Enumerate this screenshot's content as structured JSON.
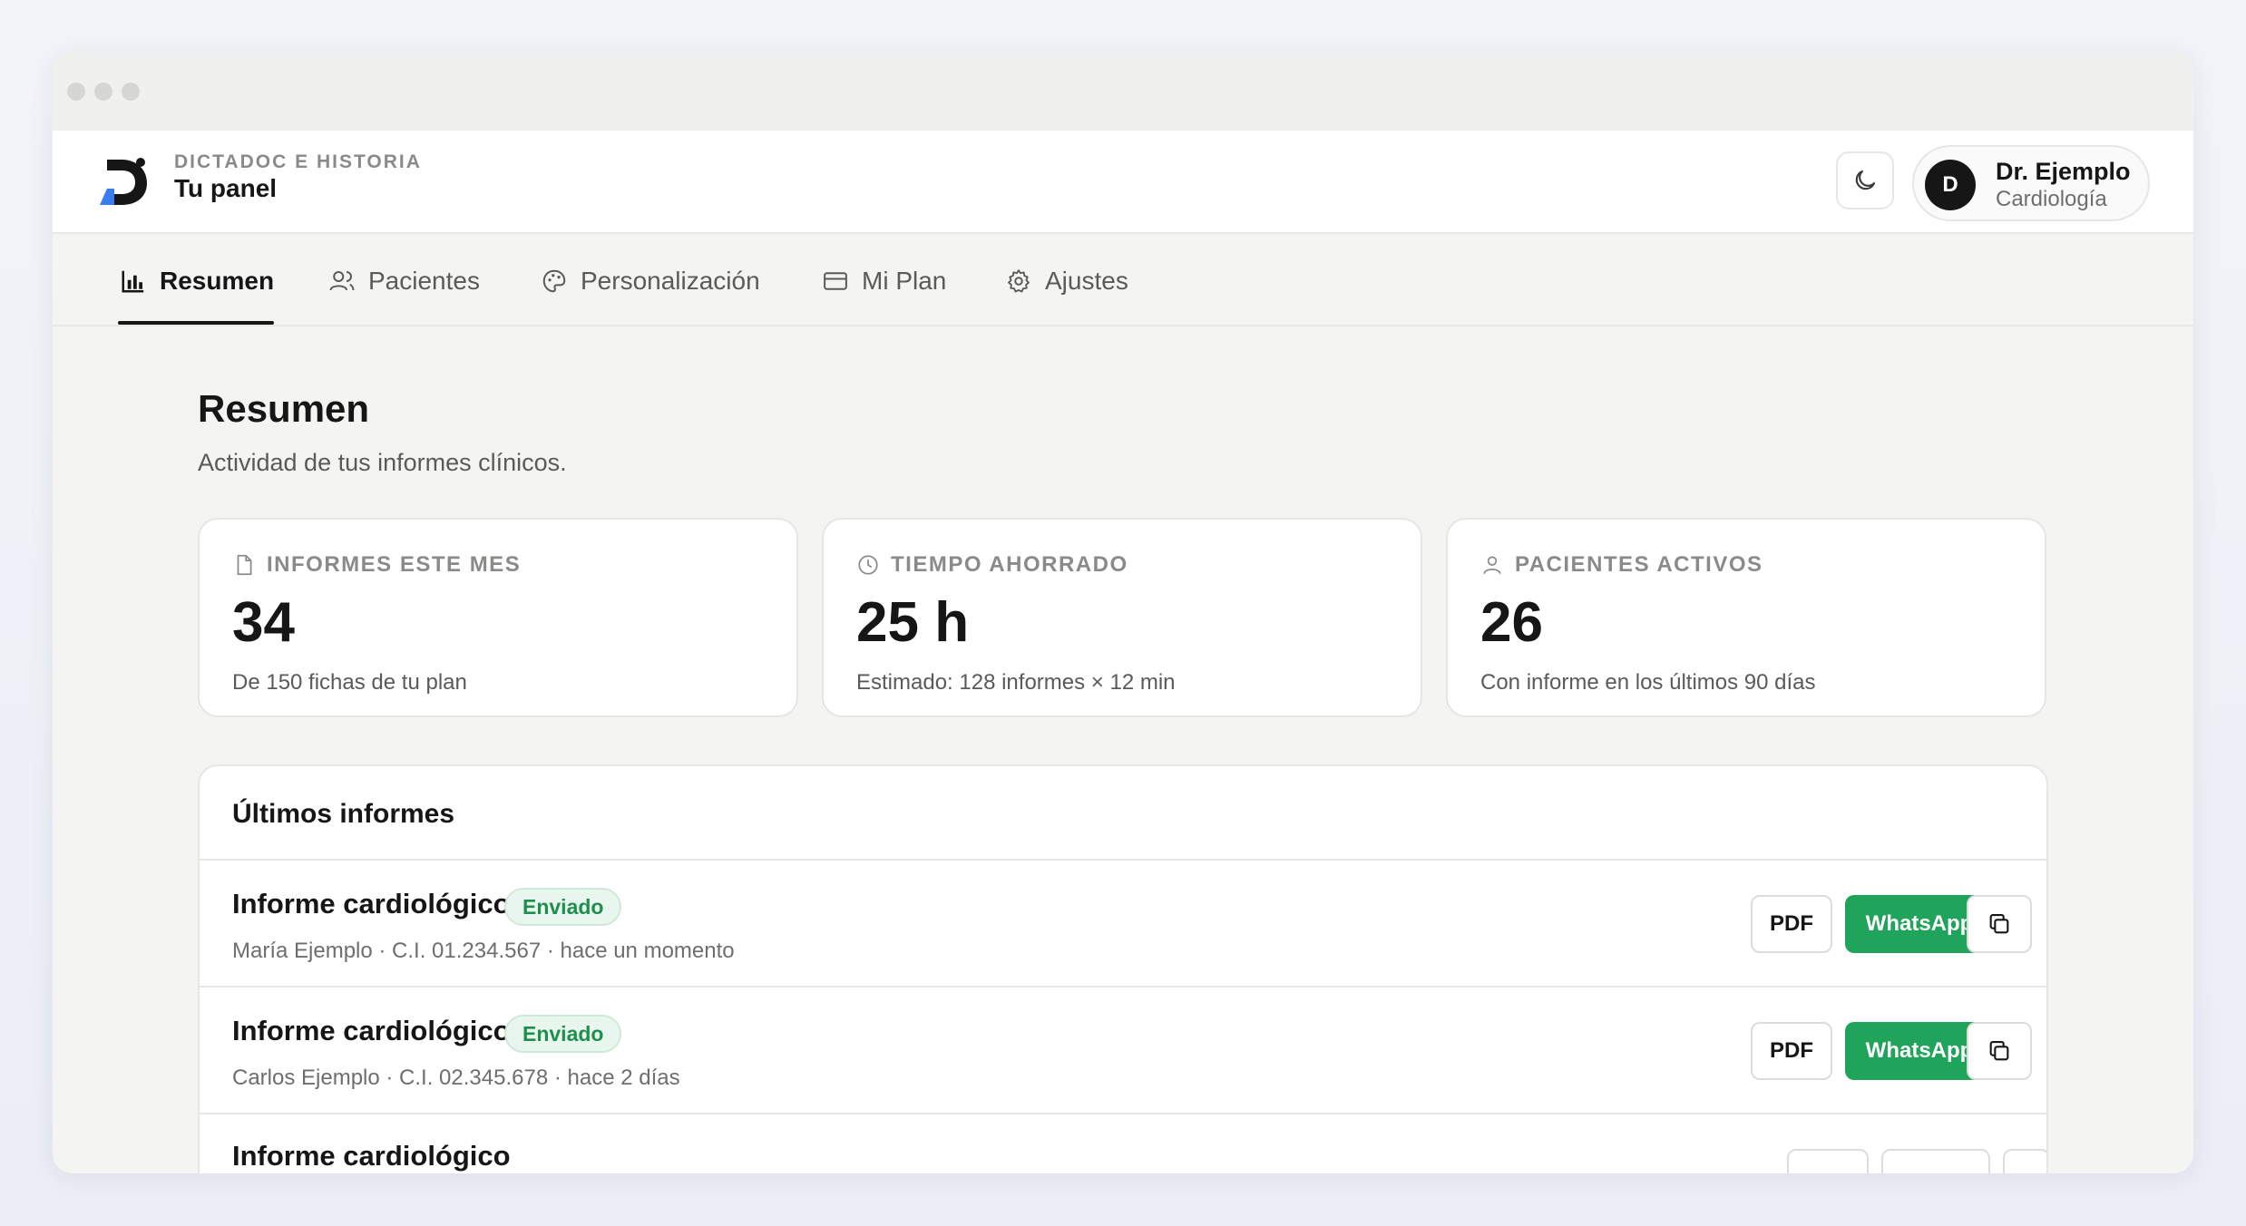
{
  "brand": {
    "kicker": "DICTADOC E HISTORIA",
    "title": "Tu panel"
  },
  "user": {
    "initial": "D",
    "name": "Dr. Ejemplo",
    "role": "Cardiología"
  },
  "nav": {
    "tabs": [
      {
        "label": "Resumen",
        "icon": "bar-chart-icon",
        "active": true
      },
      {
        "label": "Pacientes",
        "icon": "users-icon",
        "active": false
      },
      {
        "label": "Personalización",
        "icon": "palette-icon",
        "active": false
      },
      {
        "label": "Mi Plan",
        "icon": "credit-card-icon",
        "active": false
      },
      {
        "label": "Ajustes",
        "icon": "gear-icon",
        "active": false
      }
    ]
  },
  "page": {
    "title": "Resumen",
    "subtitle": "Actividad de tus informes clínicos."
  },
  "stats": [
    {
      "label": "INFORMES ESTE MES",
      "icon": "file-icon",
      "value": "34",
      "note": "De 150 fichas de tu plan"
    },
    {
      "label": "TIEMPO AHORRADO",
      "icon": "clock-icon",
      "value": "25 h",
      "note": "Estimado: 128 informes × 12 min"
    },
    {
      "label": "PACIENTES ACTIVOS",
      "icon": "user-icon",
      "value": "26",
      "note": "Con informe en los últimos 90 días"
    }
  ],
  "reports": {
    "title": "Últimos informes",
    "rows": [
      {
        "title": "Informe cardiológico",
        "badge": "Enviado",
        "meta": "María Ejemplo · C.I. 01.234.567 · hace un momento",
        "pdf": "PDF",
        "whatsapp": "WhatsApp"
      },
      {
        "title": "Informe cardiológico",
        "badge": "Enviado",
        "meta": "Carlos Ejemplo · C.I. 02.345.678 · hace 2 días",
        "pdf": "PDF",
        "whatsapp": "WhatsApp"
      },
      {
        "title": "Informe cardiológico"
      }
    ]
  },
  "colors": {
    "accent_green": "#20a35a",
    "badge_green_text": "#1e8f4e",
    "logo_blue": "#3b7bf0"
  }
}
